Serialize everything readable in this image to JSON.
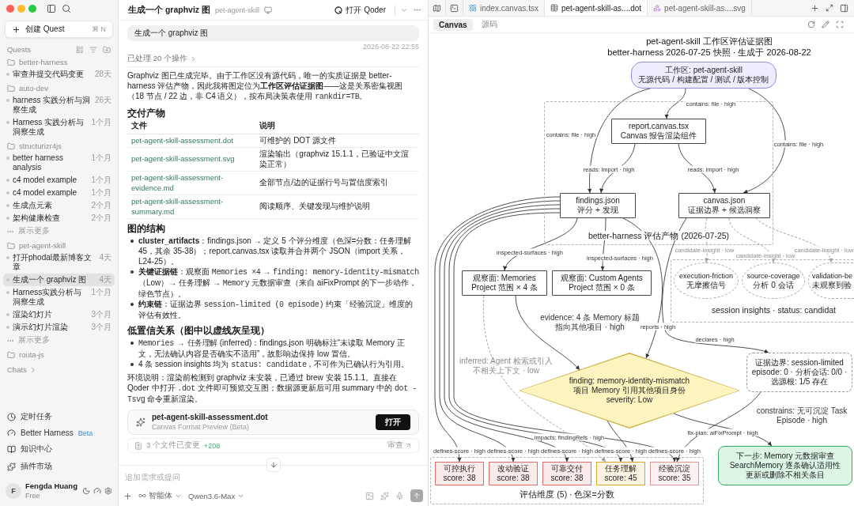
{
  "sidebar": {
    "new_quest": {
      "label": "创建 Quest",
      "shortcut": "⌘ N"
    },
    "section": "Quests",
    "groups": [
      {
        "name": "better-harness",
        "items": [
          {
            "title": "审查并提交代码变更",
            "age": "28天",
            "selected": false
          }
        ]
      },
      {
        "name": "auto-dev",
        "items": [
          {
            "title": "harness 实践分析与洞察生成",
            "age": "26天",
            "selected": false
          },
          {
            "title": "Harness 实践分析与洞察生成",
            "age": "1个月",
            "selected": false
          }
        ]
      },
      {
        "name": "structurizr4js",
        "items": [
          {
            "title": "better harness analysis",
            "age": "1个月",
            "selected": false
          },
          {
            "title": "c4 model example",
            "age": "1个月",
            "selected": false
          },
          {
            "title": "c4 model example",
            "age": "1个月",
            "selected": false
          },
          {
            "title": "生成点元素",
            "age": "2个月",
            "selected": false
          },
          {
            "title": "架构健康检查",
            "age": "2个月",
            "selected": false
          }
        ],
        "show_more": "展示更多"
      },
      {
        "name": "pet-agent-skill",
        "items": [
          {
            "title": "打开phodal最新博客文章",
            "age": "4天",
            "selected": false
          },
          {
            "title": "生成一个 graphviz 图",
            "age": "4天",
            "selected": true
          },
          {
            "title": "Harness实践分析与洞察生成",
            "age": "1个月",
            "selected": false
          },
          {
            "title": "渲染幻灯片",
            "age": "3个月",
            "selected": false
          },
          {
            "title": "演示幻灯片渲染",
            "age": "3个月",
            "selected": false
          }
        ],
        "show_more": "展示更多"
      },
      {
        "name": "routa-js"
      }
    ],
    "chats": "Chats",
    "links": [
      {
        "kind": "clock",
        "label": "定时任务"
      },
      {
        "kind": "gauge",
        "label": "Better Harness",
        "badge": "Beta"
      },
      {
        "kind": "book",
        "label": "知识中心"
      },
      {
        "kind": "plugin",
        "label": "插件市场"
      }
    ],
    "user": {
      "initial": "F",
      "name": "Fengda Huang",
      "plan": "Free"
    }
  },
  "chat": {
    "title": "生成一个 graphviz 图",
    "project": "pet-agent-skill",
    "open_label": "打开 Qoder",
    "message": "生成一个 graphviz 图",
    "timestamp": "2026-08-22 22:55",
    "processed": "已处理 20 个操作",
    "blocks": [
      {
        "kind": "paragraph",
        "segments": [
          {
            "kind": "text",
            "text": "Graphviz 图已生成完毕。由于工作区没有源代码，唯一的实质证据是 better-harness 评估产物，因此我将图定位为**工作区评估证据图**——这是关系密集视图（18 节点 / 22 边，非 C4 语义），按布局决策表使用 "
          },
          {
            "kind": "code",
            "text": "rankdir=TB"
          },
          {
            "kind": "text",
            "text": "。"
          }
        ]
      },
      {
        "kind": "heading",
        "text": "交付产物"
      },
      {
        "kind": "table",
        "columns": [
          "文件",
          "说明"
        ],
        "rows": [
          {
            "file": "pet-agent-skill-assessment.dot",
            "description": "可维护的 DOT 源文件"
          },
          {
            "file": "pet-agent-skill-assessment.svg",
            "description": "渲染输出（graphviz 15.1.1，已验证中文渲染正常）"
          },
          {
            "file": "pet-agent-skill-assessment-evidence.md",
            "description": "全部节点/边的证据行号与置信度索引"
          },
          {
            "file": "pet-agent-skill-assessment-summary.md",
            "description": "阅读顺序、关键发现与维护说明"
          }
        ]
      },
      {
        "kind": "heading",
        "text": "图的结构"
      },
      {
        "kind": "bullets",
        "items": [
          [
            {
              "kind": "text",
              "text": "**cluster_artifacts**：findings.json → 定义 5 个评分维度（色深=分数：任务理解 45，其余 35-38）；report.canvas.tsx 读取并合并两个 JSON（import 关系，L24-25）。"
            }
          ],
          [
            {
              "kind": "text",
              "text": "**关键证据链**：观察面 "
            },
            {
              "kind": "code",
              "text": "Memories ×4"
            },
            {
              "kind": "text",
              "text": " → "
            },
            {
              "kind": "code",
              "text": "finding: memory-identity-mismatch"
            },
            {
              "kind": "text",
              "text": "（Low）→ 任务理解 → "
            },
            {
              "kind": "code",
              "text": "Memory"
            },
            {
              "kind": "text",
              "text": " 元数据审查（来自 aiFixPrompt 的下一步动作，绿色节点）。"
            }
          ],
          [
            {
              "kind": "text",
              "text": "**约束链**：证据边界 "
            },
            {
              "kind": "code",
              "text": "session-limited (0 episode)"
            },
            {
              "kind": "text",
              "text": " 约束「经验沉淀」维度的评估有效性。"
            }
          ]
        ]
      },
      {
        "kind": "heading",
        "text": "低置信关系（图中以虚线灰呈现）"
      },
      {
        "kind": "bullets",
        "items": [
          [
            {
              "kind": "code",
              "text": "Memories → 任务理解"
            },
            {
              "kind": "text",
              "text": " (inferred)：findings.json 明确标注“未读取 Memory 正文，无法确认内容是否确实不适用”，故影响边保持 low 置信。"
            }
          ],
          [
            {
              "kind": "text",
              "text": "4 条 session insights 均为 "
            },
            {
              "kind": "code",
              "text": "status: candidate"
            },
            {
              "kind": "text",
              "text": "，不可作为已确认行为引用。"
            }
          ]
        ]
      },
      {
        "kind": "paragraph",
        "segments": [
          {
            "kind": "text",
            "text": "环境说明：渲染前检测到 graphviz 未安装，已通过 brew 安装 15.1.1。直接在 Qoder 中打开 "
          },
          {
            "kind": "code",
            "text": ".dot"
          },
          {
            "kind": "text",
            "text": " 文件即可预览交互图；数据源更新后可用 summary 中的 "
          },
          {
            "kind": "code",
            "text": "dot -Tsvg"
          },
          {
            "kind": "text",
            "text": " 命令重新渲染。"
          }
        ]
      }
    ],
    "file_card": {
      "name": "pet-agent-skill-assessment.dot",
      "subtitle": "Canvas Format Preview (Beta)",
      "action": "打开"
    },
    "changes": {
      "summary": "3 个文件已变更",
      "added": "+208",
      "action": "审查"
    },
    "input": {
      "placeholder": "追加需求或提问"
    },
    "mode": "智能体",
    "model": "Qwen3.6-Max"
  },
  "editor": {
    "tabs": [
      {
        "kind": "react",
        "label": "index.canvas.tsx",
        "selected": false
      },
      {
        "kind": "dot",
        "label": "pet-agent-skill-as....dot",
        "selected": true
      },
      {
        "kind": "svg",
        "label": "pet-agent-skill-as....svg",
        "selected": false
      }
    ],
    "views": [
      {
        "label": "Canvas",
        "selected": true
      },
      {
        "label": "源码",
        "selected": false
      }
    ],
    "graph": {
      "title": "pet-agent-skill 工作区评估证据图",
      "subtitle": "better-harness 2026-07-25 快照 · 生成于 2026-08-22",
      "nodes": [
        {
          "kind": "workspace",
          "lines": [
            "工作区: pet-agent-skill",
            "无源代码 / 构建配置 / 测试 / 版本控制"
          ]
        },
        {
          "kind": "cluster",
          "label": "better-harness 评估产物 (2026-07-25)",
          "nodes": [
            {
              "kind": "note",
              "lines": [
                "report.canvas.tsx",
                "Canvas 报告渲染组件"
              ]
            },
            {
              "kind": "note",
              "lines": [
                "findings.json",
                "评分 + 发现"
              ]
            },
            {
              "kind": "note",
              "lines": [
                "canvas.json",
                "证据边界 + 候选洞察"
              ]
            }
          ]
        },
        {
          "kind": "note",
          "lines": [
            "观察面: Memories",
            "Project 范围 × 4 条"
          ]
        },
        {
          "kind": "note",
          "lines": [
            "观察面: Custom Agents",
            "Project 范围 × 0 条"
          ]
        },
        {
          "kind": "cluster",
          "label": "session insights · status: candidat",
          "nodes": [
            {
              "kind": "ellipse",
              "lines": [
                "execution-friction",
                "无摩擦信号"
              ]
            },
            {
              "kind": "ellipse",
              "lines": [
                "source-coverage",
                "分析 0 会话"
              ]
            },
            {
              "kind": "ellipse",
              "lines": [
                "validation-be",
                "未观察到验"
              ]
            }
          ]
        },
        {
          "kind": "diamond",
          "lines": [
            "finding: memory-identity-mismatch",
            "项目 Memory 引用其他项目身份",
            "severity: Low"
          ]
        },
        {
          "kind": "boundary",
          "lines": [
            "证据边界: session-limited",
            "episode: 0 · 分析会话: 0/0 · 选源根: 1/5 存在"
          ]
        },
        {
          "kind": "cluster",
          "label": "评估维度 (5) · 色深=分数",
          "nodes": [
            {
              "kind": "score",
              "lines": [
                "可控执行",
                "score: 38"
              ],
              "color": "#e06c6c"
            },
            {
              "kind": "score",
              "lines": [
                "改动验证",
                "score: 38"
              ],
              "color": "#e06c6c"
            },
            {
              "kind": "score",
              "lines": [
                "可靠交付",
                "score: 38"
              ],
              "color": "#e06c6c"
            },
            {
              "kind": "score",
              "lines": [
                "任务理解",
                "score: 45"
              ],
              "color": "#d9a82a"
            },
            {
              "kind": "score",
              "lines": [
                "经验沉淀",
                "score: 35"
              ],
              "color": "#e89292"
            }
          ]
        },
        {
          "kind": "action",
          "lines": [
            "下一步: Memory 元数据审查",
            "SearchMemory 逐条确认适用性",
            "更新或删除不相关条目"
          ]
        }
      ],
      "edges": [
        {
          "label": "contains: file · high",
          "dashed": false
        },
        {
          "label": "contains: file · high",
          "dashed": false
        },
        {
          "label": "contains: file · high",
          "dashed": false
        },
        {
          "label": "reads: import · high",
          "dashed": false
        },
        {
          "label": "reads: import · high",
          "dashed": false
        },
        {
          "label": "inspected-surfaces · high",
          "dashed": false
        },
        {
          "label": "inspected-surfaces · high",
          "dashed": false
        },
        {
          "label": "candidate-insight · low",
          "dashed": true
        },
        {
          "label": "candidate-insight · low",
          "dashed": true
        },
        {
          "label": "candidate-insight · low",
          "dashed": true
        },
        {
          "label": "declares · high",
          "dashed": false
        },
        {
          "label": "reports · high",
          "dashed": false
        },
        {
          "label": "defines-score · high",
          "dashed": false
        },
        {
          "label": "defines-score · high",
          "dashed": false
        },
        {
          "label": "defines-score · high",
          "dashed": false
        },
        {
          "label": "defines-score · high",
          "dashed": false
        },
        {
          "label": "defines-score · high",
          "dashed": false
        },
        {
          "label": "evidence: 4 条 Memory 标题指向其他项目 · high",
          "dashed": false
        },
        {
          "label": "inferred: Agent 检索或引入不相关上下文 · low",
          "dashed": true
        },
        {
          "label": "constrains: 无可沉淀 Task Episode · high",
          "dashed": false
        },
        {
          "label": "fix-plan: aiFixPrompt · high",
          "dashed": false
        },
        {
          "label": "impacts: findingRefs · high",
          "dashed": false
        }
      ]
    }
  }
}
